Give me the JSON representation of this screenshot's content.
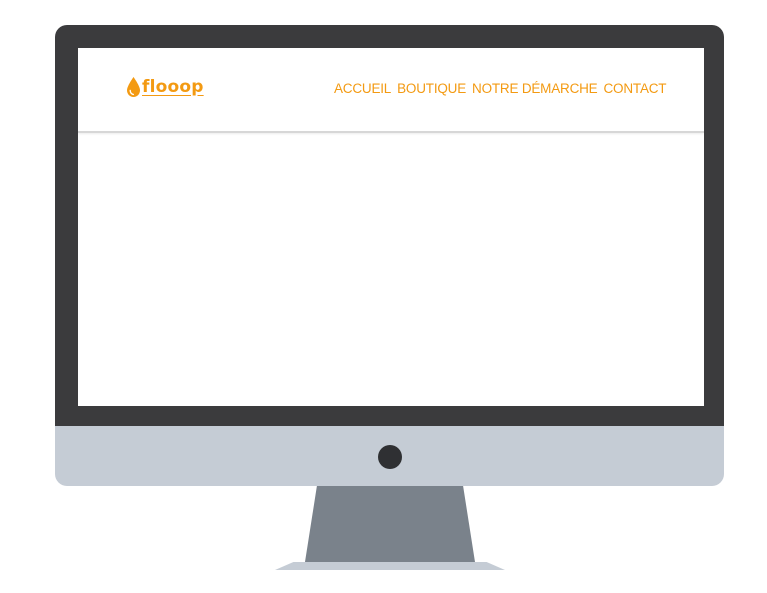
{
  "site": {
    "logo_text": "flooop",
    "logo_icon": "drop-icon",
    "brand_color": "#f39a12"
  },
  "nav": {
    "items": [
      {
        "label": "ACCUEIL"
      },
      {
        "label": "BOUTIQUE"
      },
      {
        "label": "NOTRE DÉMARCHE"
      },
      {
        "label": "CONTACT"
      }
    ]
  },
  "colors": {
    "bezel": "#3b3b3d",
    "chin": "#c5ccd5",
    "stand": "#7a828b"
  }
}
